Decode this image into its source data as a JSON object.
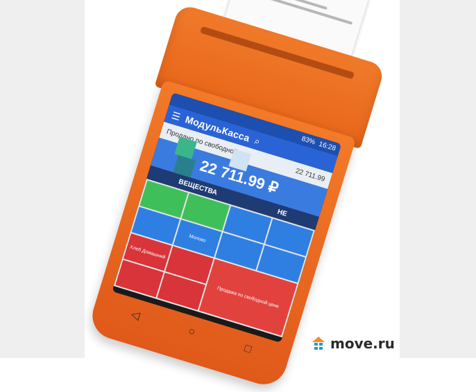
{
  "device": {
    "status_time": "16:28",
    "status_battery": "83%",
    "app_title": "МодульКасса",
    "sale_label": "Продано по свободной",
    "sale_amount": "22 711.99",
    "total": "22 711.99 ₽",
    "tabs": [
      "ВЕЩЕСТВА",
      "НЕ"
    ],
    "tiles": [
      {
        "label": "Хлеб Домашний",
        "color": "red"
      },
      {
        "label": "Молоко",
        "color": "blue"
      },
      {
        "label": "Продажа по свободной цене",
        "color": "red"
      }
    ],
    "nav_icons": [
      "back-icon",
      "home-icon",
      "recents-icon"
    ]
  },
  "watermark": {
    "text": "move.ru",
    "roof_color": "#f28c28",
    "grid_color": "#1e9bd6"
  },
  "colors": {
    "device_orange": "#f27a28",
    "app_blue": "#2a63d6",
    "total_blue": "#3a7be0"
  }
}
